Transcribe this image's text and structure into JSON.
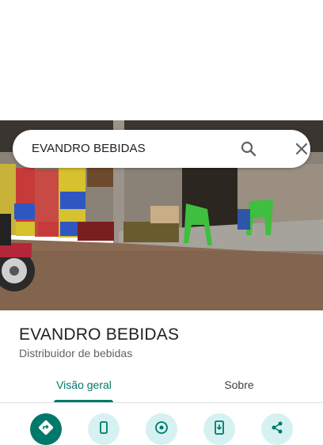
{
  "search": {
    "query": "EVANDRO BEBIDAS",
    "search_icon": "search-icon",
    "close_icon": "close-icon"
  },
  "place": {
    "name": "EVANDRO BEBIDAS",
    "category": "Distribuidor de bebidas"
  },
  "tabs": [
    {
      "label": "Visão geral",
      "selected": true
    },
    {
      "label": "Sobre",
      "selected": false
    }
  ],
  "actions": [
    {
      "icon": "directions-icon"
    },
    {
      "icon": "phone-icon"
    },
    {
      "icon": "nearby-icon"
    },
    {
      "icon": "send-to-phone-icon"
    },
    {
      "icon": "share-icon"
    }
  ],
  "colors": {
    "accent": "#00796b",
    "action_background": "#d6f1f1",
    "title": "#202124",
    "subtitle": "#5f6368"
  }
}
